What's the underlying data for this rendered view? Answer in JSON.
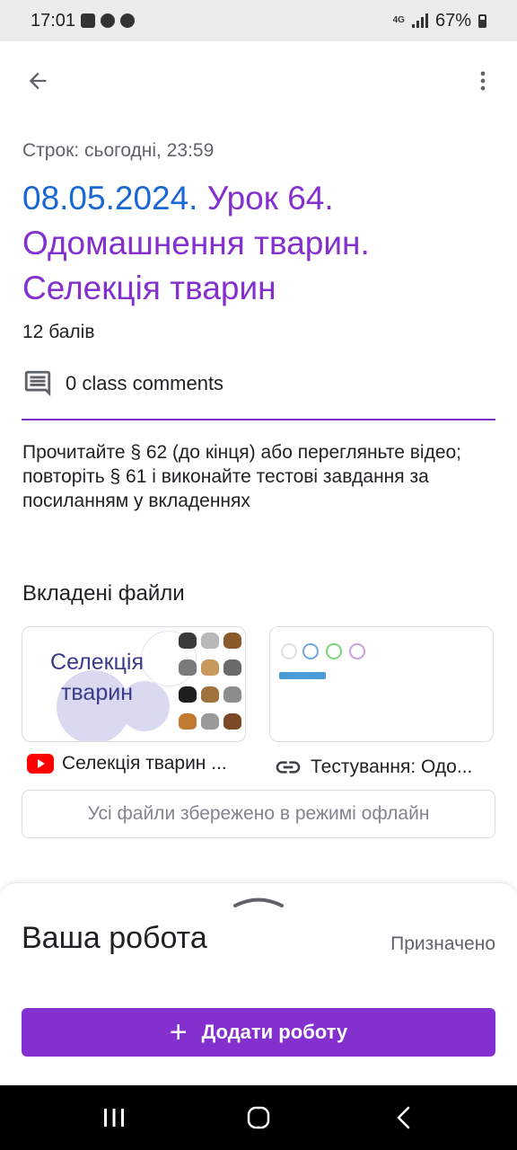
{
  "status_bar": {
    "time": "17:01",
    "network": "4G",
    "battery": "67%"
  },
  "assignment": {
    "due": "Строк: сьогодні, 23:59",
    "title_date": "08.05.2024.",
    "title_rest": "Урок 64. Одомашнення тварин. Селекція тварин",
    "points": "12 балів",
    "comments": "0 class comments",
    "description": "Прочитайте § 62 (до кінця) або перегляньте відео; повторіть § 61 і виконайте тестові завдання за посиланням у вкладеннях"
  },
  "attachments": {
    "heading": "Вкладені файли",
    "items": [
      {
        "label": "Селекція тварин ...",
        "icon": "youtube-icon",
        "thumb_text": "Селекція тварин"
      },
      {
        "label": "Тестування: Одо...",
        "icon": "link-icon"
      }
    ],
    "offline_notice": "Усі файли збережено в режимі офлайн"
  },
  "your_work": {
    "title": "Ваша робота",
    "status": "Призначено",
    "add_button": "Додати роботу"
  },
  "colors": {
    "accent": "#8430ce",
    "date_blue": "#1967d2",
    "youtube_red": "#ff0000"
  }
}
